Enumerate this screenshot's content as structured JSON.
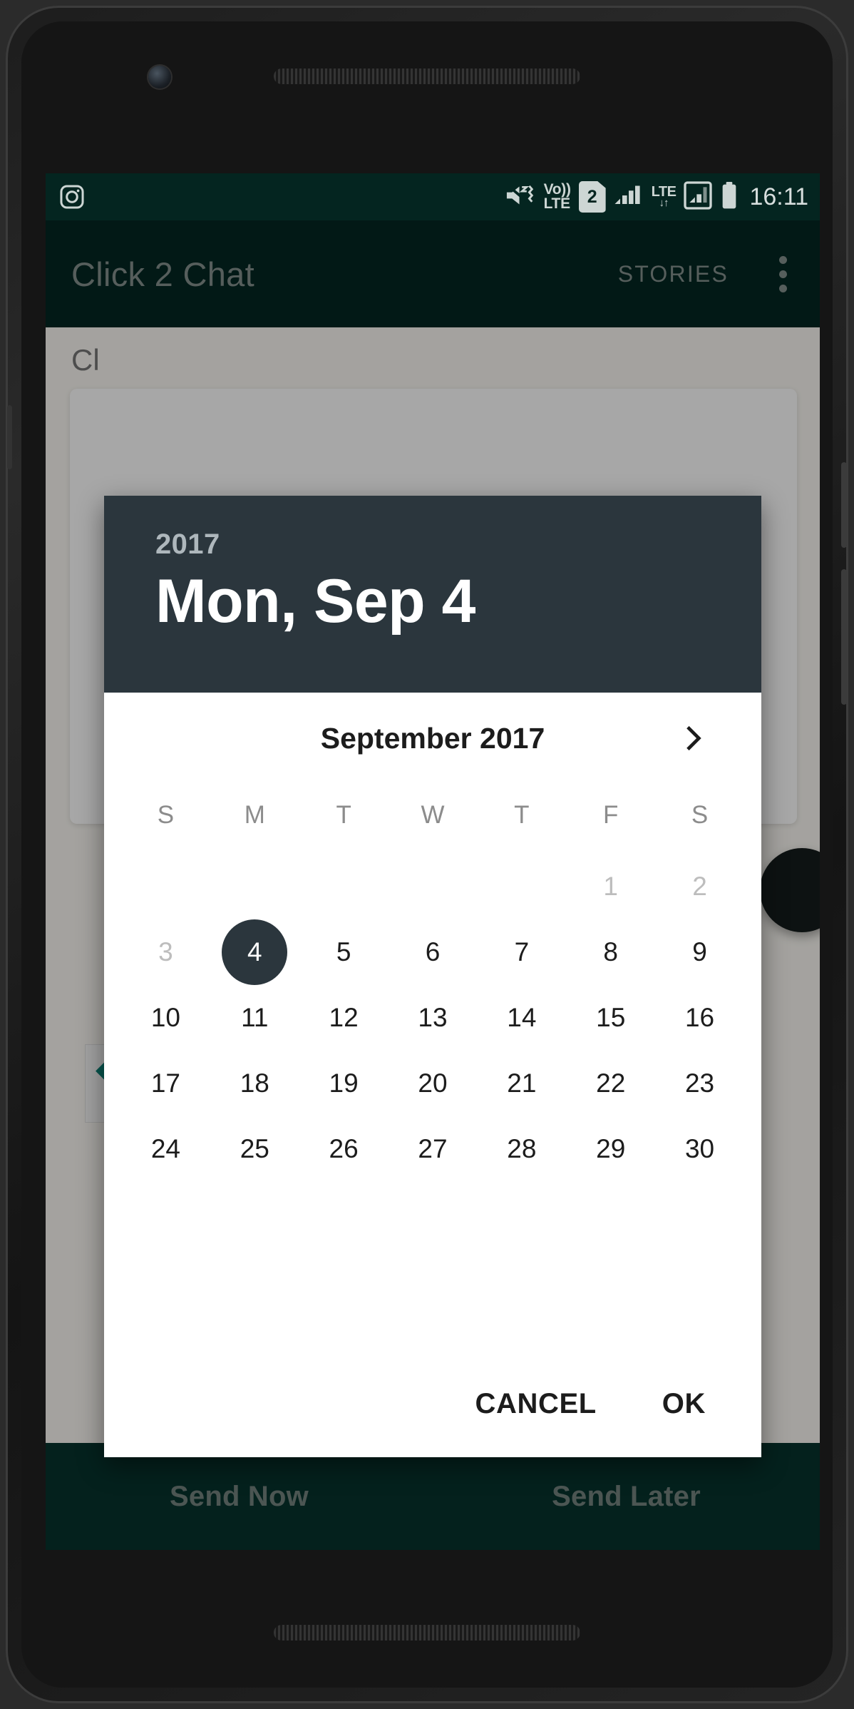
{
  "status_bar": {
    "left_icon": "instagram-icon",
    "icons": [
      "volume-mute-vibrate-icon",
      "volte-icon",
      "sim2-badge",
      "signal-bars-icon",
      "lte-data-icon",
      "signal-secondary-icon",
      "battery-icon"
    ],
    "volte_top": "Vo))",
    "volte_bottom": "LTE",
    "sim_number": "2",
    "lte_label": "LTE",
    "lte_arrows": "↓↑",
    "time": "16:11"
  },
  "toolbar": {
    "app_title": "Click 2 Chat",
    "stories_tab": "STORIES",
    "overflow_menu": "more-options"
  },
  "app_background": {
    "content_heading": "Cl",
    "send_now_label": "Send Now",
    "send_later_label": "Send Later"
  },
  "date_picker": {
    "header": {
      "year": "2017",
      "selected_date": "Mon, Sep 4"
    },
    "month_label": "September 2017",
    "next_arrow": "chevron-right-icon",
    "weekdays": [
      "S",
      "M",
      "T",
      "W",
      "T",
      "F",
      "S"
    ],
    "leading_blanks": 5,
    "prev_month_tail": [
      "1",
      "2"
    ],
    "days": [
      "3",
      "4",
      "5",
      "6",
      "7",
      "8",
      "9",
      "10",
      "11",
      "12",
      "13",
      "14",
      "15",
      "16",
      "17",
      "18",
      "19",
      "20",
      "21",
      "22",
      "23",
      "24",
      "25",
      "26",
      "27",
      "28",
      "29",
      "30"
    ],
    "muted_days": [
      "1",
      "2",
      "3"
    ],
    "selected_day": "4",
    "cancel_label": "CANCEL",
    "ok_label": "OK"
  },
  "colors": {
    "toolbar_green": "#042520",
    "dialog_header": "#2b363d",
    "selected_day_bg": "#2b363d",
    "bottom_bar": "#06302a",
    "muted_text": "#bdbdbd"
  }
}
